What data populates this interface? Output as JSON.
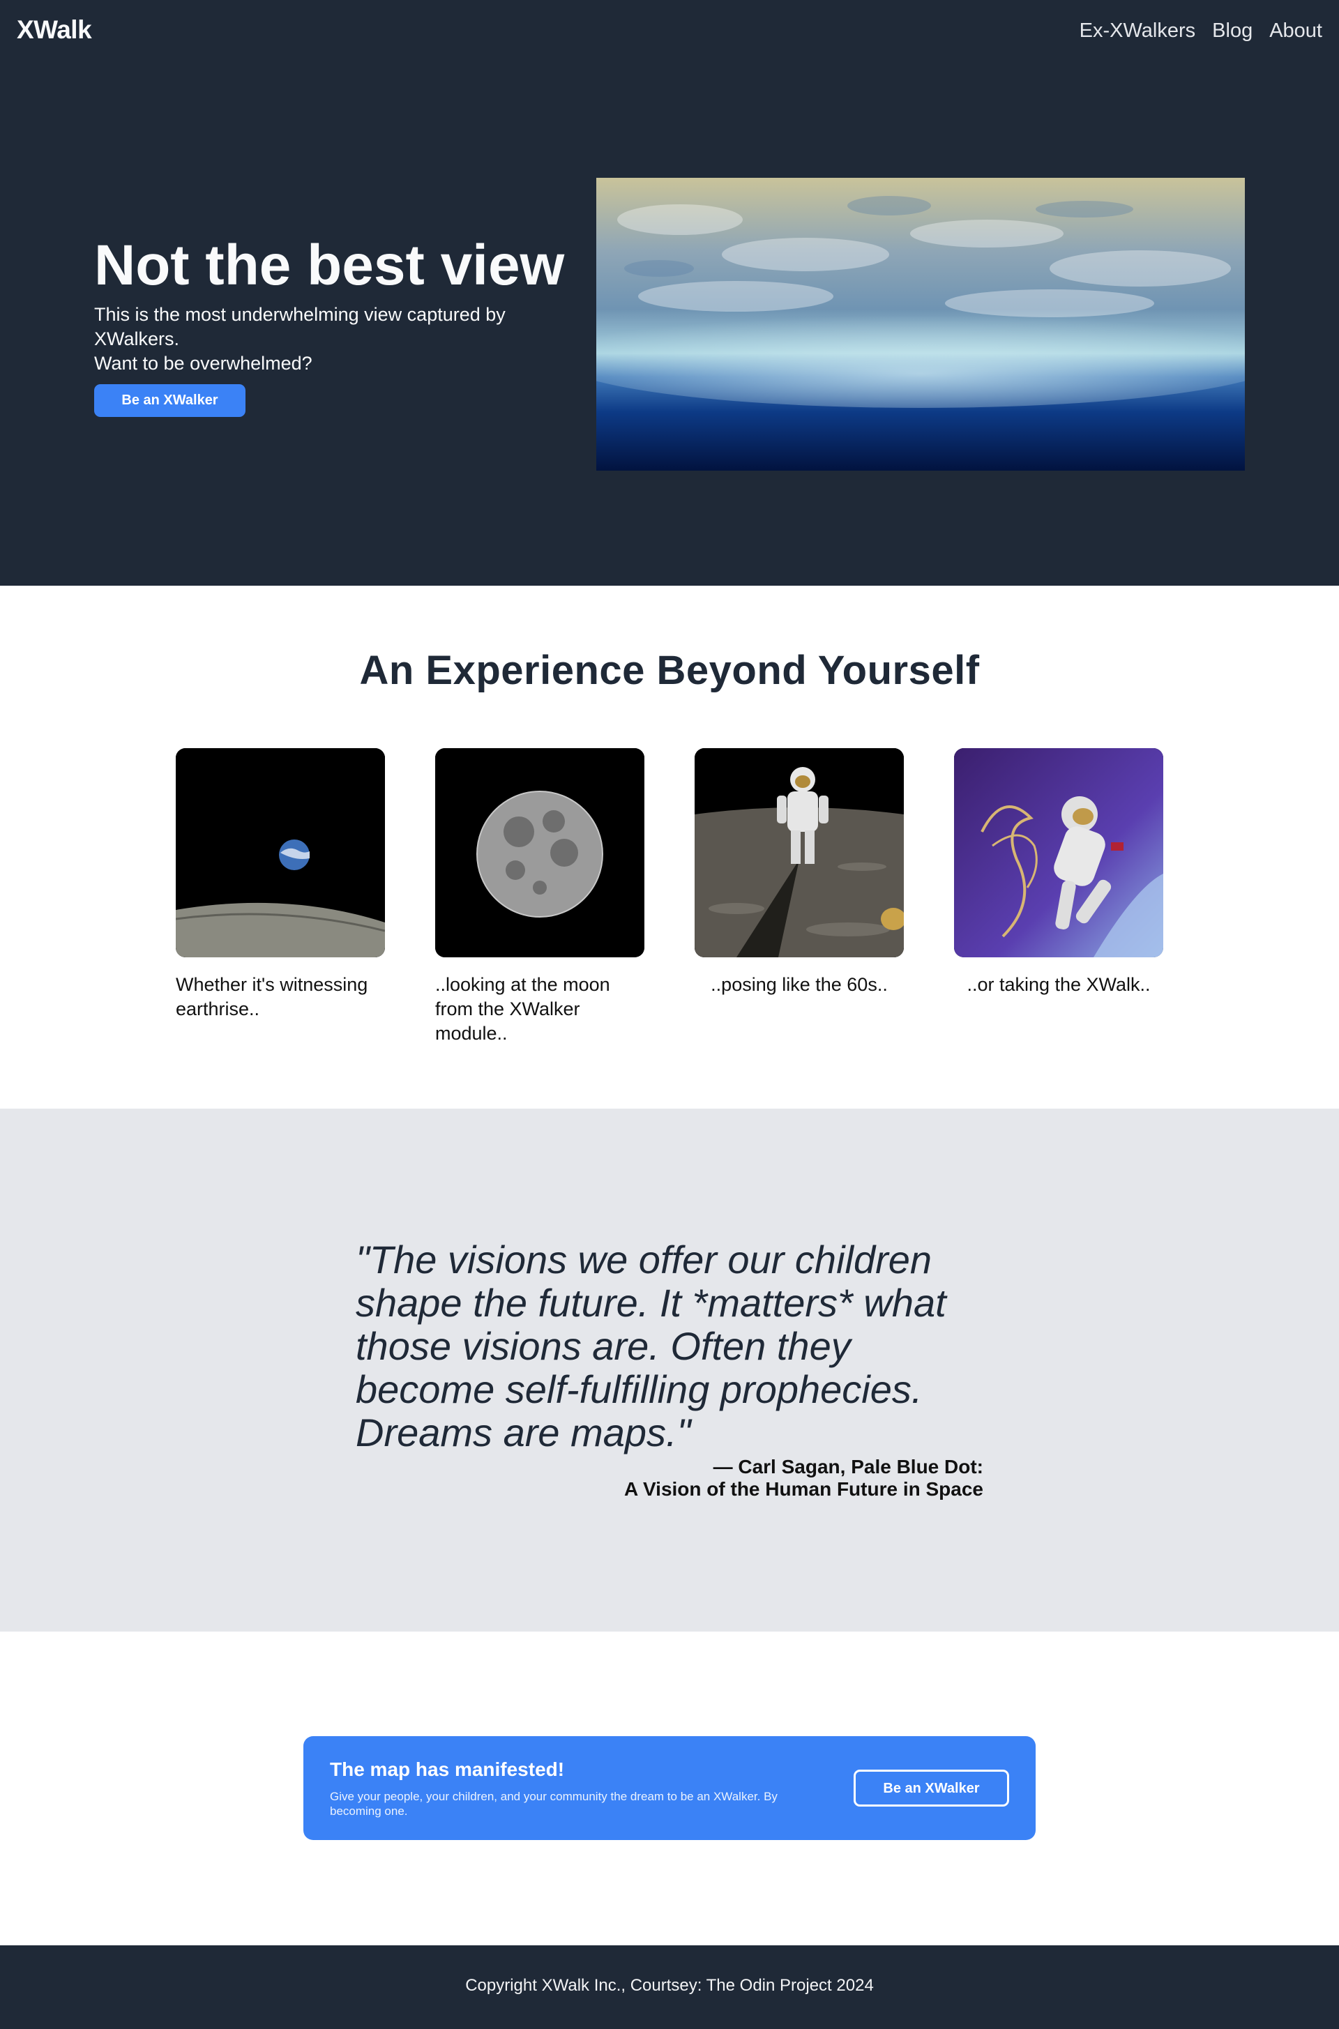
{
  "header": {
    "brand": "XWalk",
    "nav": [
      "Ex-XWalkers",
      "Blog",
      "About"
    ]
  },
  "hero": {
    "title": "Not the best view",
    "subtitle_line1": "This is the most underwhelming view captured by XWalkers.",
    "subtitle_line2": "Want to be overwhelmed?",
    "button": "Be an XWalker",
    "image": "earth-horizon-image"
  },
  "experience": {
    "title": "An Experience Beyond Yourself",
    "cards": [
      {
        "image": "earthrise-image",
        "caption": "Whether it's witnessing earthrise.."
      },
      {
        "image": "full-moon-image",
        "caption": "..looking at the moon from the XWalker module.."
      },
      {
        "image": "astronaut-on-moon-image",
        "caption": "..posing like the 60s.."
      },
      {
        "image": "spacewalk-image",
        "caption": "..or taking the XWalk.."
      }
    ]
  },
  "quote": {
    "text": "\"The visions we offer our children shape the future. It *matters* what those visions are. Often they become self-fulfilling prophecies. Dreams are maps.\"",
    "attribution_line1": "— Carl Sagan, Pale Blue Dot:",
    "attribution_line2": "A Vision of the Human Future in Space"
  },
  "cta": {
    "title": "The map has manifested!",
    "text": "Give your people, your children, and your community the dream to be an XWalker. By becoming one.",
    "button": "Be an XWalker"
  },
  "footer": {
    "text": "Copyright XWalk Inc., Courtsey: The Odin Project 2024"
  },
  "colors": {
    "dark": "#1f2937",
    "accent": "#3b82f6",
    "light_band": "#e5e7eb"
  }
}
